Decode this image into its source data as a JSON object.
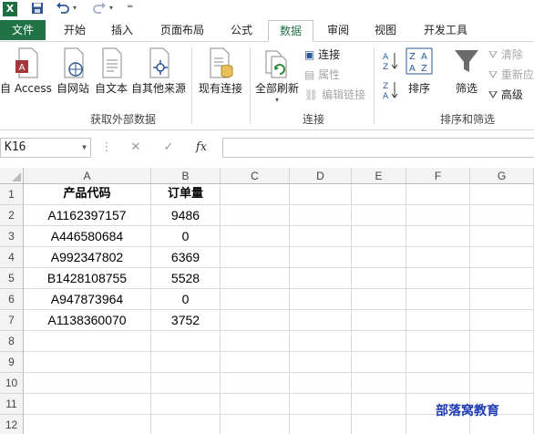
{
  "titlebar": {
    "app_logo": "X",
    "undo_icon": "undo-icon",
    "redo_icon": "redo-icon",
    "save_icon": "save-icon",
    "customize_icon": "customize-qat-icon"
  },
  "tabs": [
    {
      "label": "文件"
    },
    {
      "label": "开始"
    },
    {
      "label": "插入"
    },
    {
      "label": "页面布局"
    },
    {
      "label": "公式"
    },
    {
      "label": "数据"
    },
    {
      "label": "审阅"
    },
    {
      "label": "视图"
    },
    {
      "label": "开发工具"
    }
  ],
  "ribbon": {
    "get_external": {
      "group_label": "获取外部数据",
      "from_access": "自 Access",
      "from_web": "自网站",
      "from_text": "自文本",
      "from_other": "自其他来源",
      "existing": "现有连接"
    },
    "connections": {
      "group_label": "连接",
      "refresh_all": "全部刷新",
      "connections": "连接",
      "properties": "属性",
      "edit_links": "编辑链接"
    },
    "sort_filter": {
      "group_label": "排序和筛选",
      "sort": "排序",
      "filter": "筛选",
      "clear": "清除",
      "reapply": "重新应",
      "advanced": "高级"
    }
  },
  "formula_bar": {
    "name_box": "K16",
    "cancel": "✕",
    "enter": "✓",
    "fx": "fx",
    "value": ""
  },
  "sheet": {
    "columns": [
      "A",
      "B",
      "C",
      "D",
      "E",
      "F",
      "G"
    ],
    "rows": [
      "1",
      "2",
      "3",
      "4",
      "5",
      "6",
      "7",
      "8",
      "9",
      "10",
      "11",
      "12"
    ],
    "header": [
      "产品代码",
      "订单量"
    ],
    "data": [
      [
        "A1162397157",
        "9486"
      ],
      [
        "A446580684",
        "0"
      ],
      [
        "A992347802",
        "6369"
      ],
      [
        "B1428108755",
        "5528"
      ],
      [
        "A947873964",
        "0"
      ],
      [
        "A1138360070",
        "3752"
      ]
    ]
  },
  "watermark": "部落窝教育"
}
